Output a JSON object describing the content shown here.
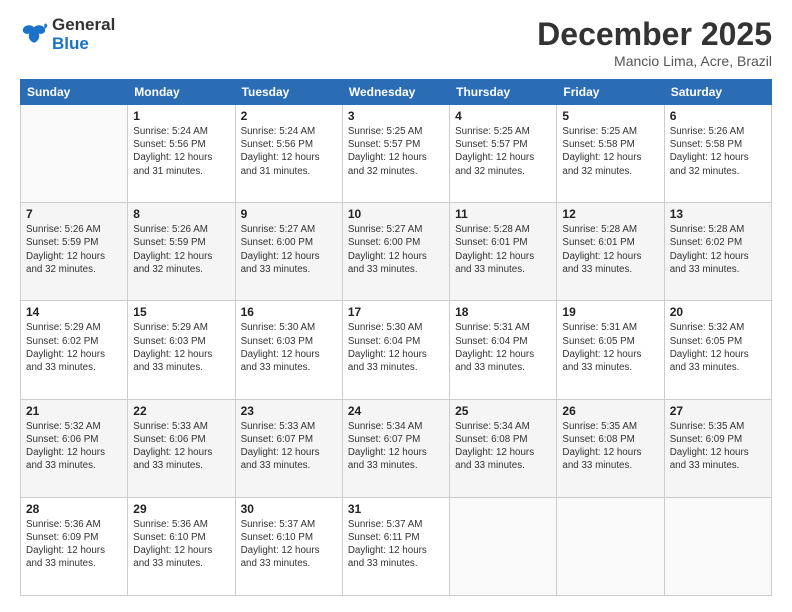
{
  "header": {
    "logo_line1": "General",
    "logo_line2": "Blue",
    "month": "December 2025",
    "location": "Mancio Lima, Acre, Brazil"
  },
  "weekdays": [
    "Sunday",
    "Monday",
    "Tuesday",
    "Wednesday",
    "Thursday",
    "Friday",
    "Saturday"
  ],
  "weeks": [
    [
      {
        "day": "",
        "info": ""
      },
      {
        "day": "1",
        "info": "Sunrise: 5:24 AM\nSunset: 5:56 PM\nDaylight: 12 hours\nand 31 minutes."
      },
      {
        "day": "2",
        "info": "Sunrise: 5:24 AM\nSunset: 5:56 PM\nDaylight: 12 hours\nand 31 minutes."
      },
      {
        "day": "3",
        "info": "Sunrise: 5:25 AM\nSunset: 5:57 PM\nDaylight: 12 hours\nand 32 minutes."
      },
      {
        "day": "4",
        "info": "Sunrise: 5:25 AM\nSunset: 5:57 PM\nDaylight: 12 hours\nand 32 minutes."
      },
      {
        "day": "5",
        "info": "Sunrise: 5:25 AM\nSunset: 5:58 PM\nDaylight: 12 hours\nand 32 minutes."
      },
      {
        "day": "6",
        "info": "Sunrise: 5:26 AM\nSunset: 5:58 PM\nDaylight: 12 hours\nand 32 minutes."
      }
    ],
    [
      {
        "day": "7",
        "info": "Sunrise: 5:26 AM\nSunset: 5:59 PM\nDaylight: 12 hours\nand 32 minutes."
      },
      {
        "day": "8",
        "info": "Sunrise: 5:26 AM\nSunset: 5:59 PM\nDaylight: 12 hours\nand 32 minutes."
      },
      {
        "day": "9",
        "info": "Sunrise: 5:27 AM\nSunset: 6:00 PM\nDaylight: 12 hours\nand 33 minutes."
      },
      {
        "day": "10",
        "info": "Sunrise: 5:27 AM\nSunset: 6:00 PM\nDaylight: 12 hours\nand 33 minutes."
      },
      {
        "day": "11",
        "info": "Sunrise: 5:28 AM\nSunset: 6:01 PM\nDaylight: 12 hours\nand 33 minutes."
      },
      {
        "day": "12",
        "info": "Sunrise: 5:28 AM\nSunset: 6:01 PM\nDaylight: 12 hours\nand 33 minutes."
      },
      {
        "day": "13",
        "info": "Sunrise: 5:28 AM\nSunset: 6:02 PM\nDaylight: 12 hours\nand 33 minutes."
      }
    ],
    [
      {
        "day": "14",
        "info": "Sunrise: 5:29 AM\nSunset: 6:02 PM\nDaylight: 12 hours\nand 33 minutes."
      },
      {
        "day": "15",
        "info": "Sunrise: 5:29 AM\nSunset: 6:03 PM\nDaylight: 12 hours\nand 33 minutes."
      },
      {
        "day": "16",
        "info": "Sunrise: 5:30 AM\nSunset: 6:03 PM\nDaylight: 12 hours\nand 33 minutes."
      },
      {
        "day": "17",
        "info": "Sunrise: 5:30 AM\nSunset: 6:04 PM\nDaylight: 12 hours\nand 33 minutes."
      },
      {
        "day": "18",
        "info": "Sunrise: 5:31 AM\nSunset: 6:04 PM\nDaylight: 12 hours\nand 33 minutes."
      },
      {
        "day": "19",
        "info": "Sunrise: 5:31 AM\nSunset: 6:05 PM\nDaylight: 12 hours\nand 33 minutes."
      },
      {
        "day": "20",
        "info": "Sunrise: 5:32 AM\nSunset: 6:05 PM\nDaylight: 12 hours\nand 33 minutes."
      }
    ],
    [
      {
        "day": "21",
        "info": "Sunrise: 5:32 AM\nSunset: 6:06 PM\nDaylight: 12 hours\nand 33 minutes."
      },
      {
        "day": "22",
        "info": "Sunrise: 5:33 AM\nSunset: 6:06 PM\nDaylight: 12 hours\nand 33 minutes."
      },
      {
        "day": "23",
        "info": "Sunrise: 5:33 AM\nSunset: 6:07 PM\nDaylight: 12 hours\nand 33 minutes."
      },
      {
        "day": "24",
        "info": "Sunrise: 5:34 AM\nSunset: 6:07 PM\nDaylight: 12 hours\nand 33 minutes."
      },
      {
        "day": "25",
        "info": "Sunrise: 5:34 AM\nSunset: 6:08 PM\nDaylight: 12 hours\nand 33 minutes."
      },
      {
        "day": "26",
        "info": "Sunrise: 5:35 AM\nSunset: 6:08 PM\nDaylight: 12 hours\nand 33 minutes."
      },
      {
        "day": "27",
        "info": "Sunrise: 5:35 AM\nSunset: 6:09 PM\nDaylight: 12 hours\nand 33 minutes."
      }
    ],
    [
      {
        "day": "28",
        "info": "Sunrise: 5:36 AM\nSunset: 6:09 PM\nDaylight: 12 hours\nand 33 minutes."
      },
      {
        "day": "29",
        "info": "Sunrise: 5:36 AM\nSunset: 6:10 PM\nDaylight: 12 hours\nand 33 minutes."
      },
      {
        "day": "30",
        "info": "Sunrise: 5:37 AM\nSunset: 6:10 PM\nDaylight: 12 hours\nand 33 minutes."
      },
      {
        "day": "31",
        "info": "Sunrise: 5:37 AM\nSunset: 6:11 PM\nDaylight: 12 hours\nand 33 minutes."
      },
      {
        "day": "",
        "info": ""
      },
      {
        "day": "",
        "info": ""
      },
      {
        "day": "",
        "info": ""
      }
    ]
  ]
}
